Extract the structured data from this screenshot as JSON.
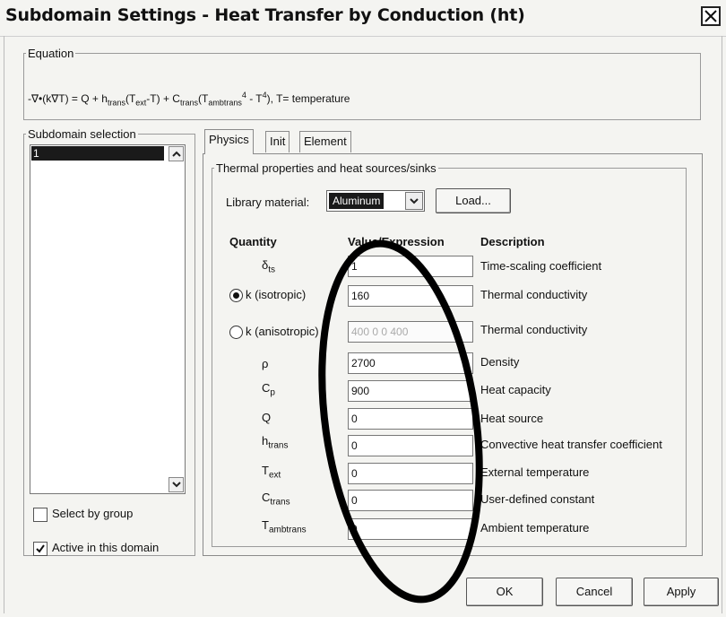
{
  "window": {
    "title": "Subdomain Settings - Heat Transfer by Conduction (ht)"
  },
  "equation": {
    "legend": "Equation",
    "p1": "-∇•(k∇T) = Q + h",
    "s1": "trans",
    "p2": "(T",
    "s2": "ext",
    "p3": "-T) + C",
    "s3": "trans",
    "p4": "(T",
    "s4": "ambtrans",
    "sup1": "4",
    "p5": " - T",
    "sup2": "4",
    "p6": "), T= temperature"
  },
  "subdomain": {
    "legend": "Subdomain selection",
    "selected_item": "1",
    "select_by_group": "Select by group",
    "active_in_domain": "Active in this domain"
  },
  "tabs": [
    "Physics",
    "Init",
    "Element"
  ],
  "physics": {
    "group_legend": "Thermal properties and heat sources/sinks",
    "library_label": "Library material:",
    "library_value": "Aluminum",
    "load_button": "Load...",
    "headers": {
      "quantity": "Quantity",
      "value": "Value/Expression",
      "description": "Description"
    },
    "rows": [
      {
        "q": "δ",
        "sub": "ts",
        "value": "1",
        "desc": "Time-scaling coefficient"
      },
      {
        "q": "k (isotropic)",
        "sub": "",
        "value": "160",
        "desc": "Thermal conductivity"
      },
      {
        "q": "k (anisotropic)",
        "sub": "",
        "value": "400 0 0 400",
        "desc": "Thermal conductivity"
      },
      {
        "q": "ρ",
        "sub": "",
        "value": "2700",
        "desc": "Density"
      },
      {
        "q": "C",
        "sub": "p",
        "value": "900",
        "desc": "Heat capacity"
      },
      {
        "q": "Q",
        "sub": "",
        "value": "0",
        "desc": "Heat source"
      },
      {
        "q": "h",
        "sub": "trans",
        "value": "0",
        "desc": "Convective heat transfer coefficient"
      },
      {
        "q": "T",
        "sub": "ext",
        "value": "0",
        "desc": "External temperature"
      },
      {
        "q": "C",
        "sub": "trans",
        "value": "0",
        "desc": "User-defined constant"
      },
      {
        "q": "T",
        "sub": "ambtrans",
        "value": "0",
        "desc": "Ambient temperature"
      }
    ]
  },
  "buttons": {
    "ok": "OK",
    "cancel": "Cancel",
    "apply": "Apply"
  }
}
